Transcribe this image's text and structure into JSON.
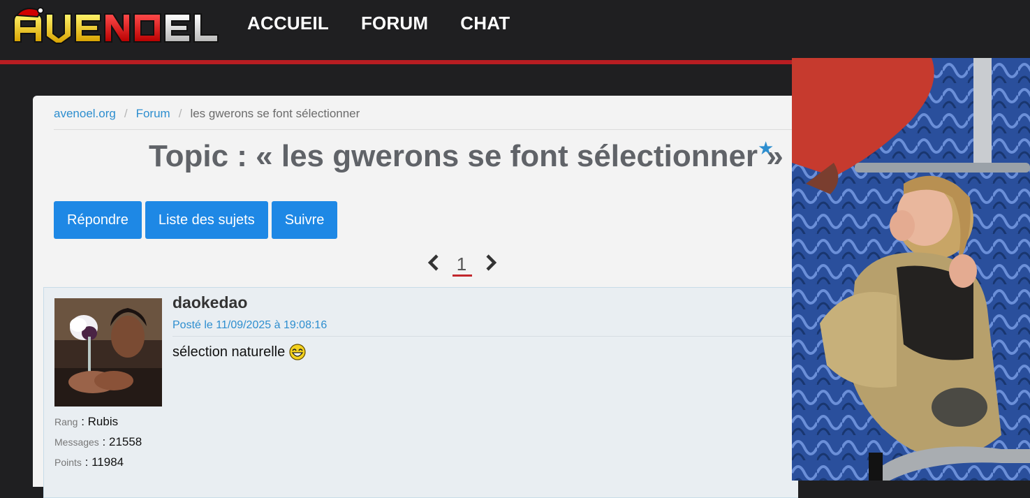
{
  "header": {
    "logo_text": "AVENOEL",
    "nav": [
      "ACCUEIL",
      "FORUM",
      "CHAT"
    ]
  },
  "breadcrumb": {
    "site": "avenoel.org",
    "section": "Forum",
    "current": "les gwerons se font sélectionner",
    "sep": "/"
  },
  "topic": {
    "title": "Topic : « les gwerons se font sélectionner »"
  },
  "actions": {
    "reply": "Répondre",
    "list": "Liste des sujets",
    "follow": "Suivre"
  },
  "pagination": {
    "current_page": "1"
  },
  "post": {
    "author": "daokedao",
    "posted": "Posté le 11/09/2025 à 19:08:16",
    "content": "sélection naturelle",
    "stats": {
      "rank_label": "Rang",
      "rank_value": ": Rubis",
      "messages_label": "Messages",
      "messages_value": ": 21558",
      "points_label": "Points",
      "points_value": ": 11984"
    }
  },
  "colors": {
    "accent": "#1e88e5",
    "link": "#2d8ecf",
    "header_bg": "#1f1f21",
    "header_rule": "#b81d22"
  }
}
